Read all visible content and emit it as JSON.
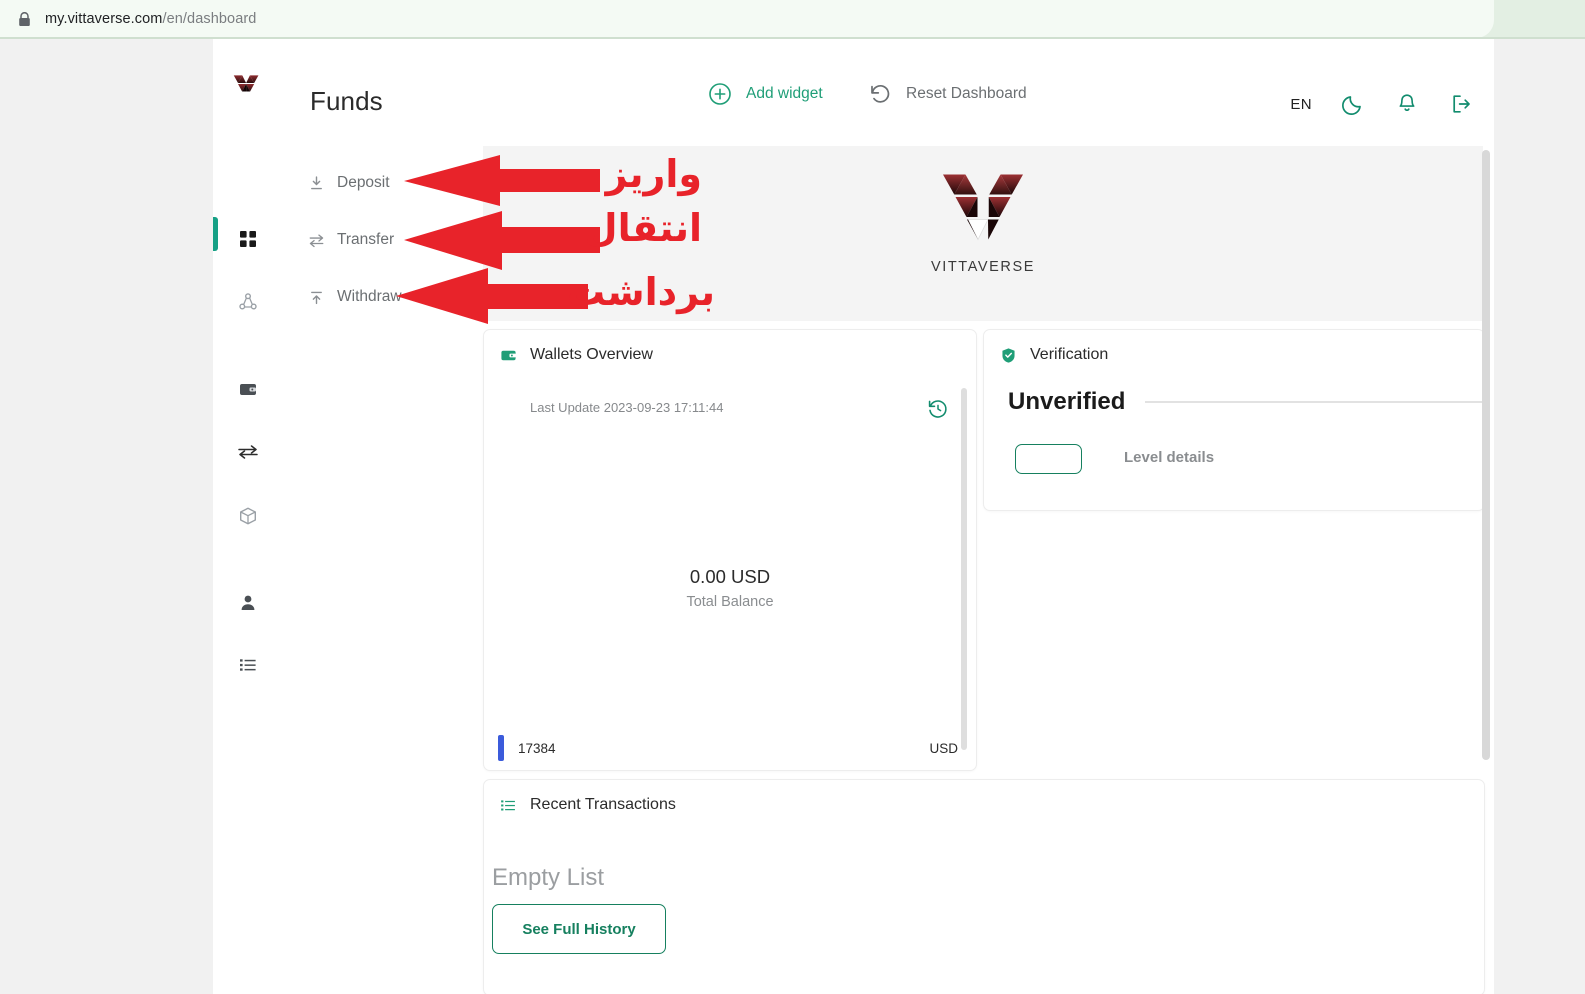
{
  "browser": {
    "lock_icon": "lock-icon",
    "url_host": "my.vittaverse.com",
    "url_path": "/en/dashboard"
  },
  "rail": {
    "logo_alt": "vittaverse-logo",
    "items": [
      {
        "name": "dashboard",
        "icon": "grid-icon",
        "active": true
      },
      {
        "name": "nodes",
        "icon": "network-icon",
        "active": false
      },
      {
        "name": "wallet",
        "icon": "wallet-icon",
        "active": false
      },
      {
        "name": "exchange",
        "icon": "exchange-arrows-icon",
        "active": false
      },
      {
        "name": "packages",
        "icon": "box-icon",
        "active": false
      },
      {
        "name": "profile",
        "icon": "person-icon",
        "active": false
      },
      {
        "name": "reports",
        "icon": "list-icon",
        "active": false
      }
    ]
  },
  "funds": {
    "title": "Funds",
    "items": [
      {
        "label": "Deposit",
        "icon": "arrow-down-to-line-icon"
      },
      {
        "label": "Transfer",
        "icon": "two-way-arrows-icon"
      },
      {
        "label": "Withdraw",
        "icon": "arrow-up-from-line-icon"
      }
    ]
  },
  "toolbar": {
    "add_widget_label": "Add widget",
    "add_widget_icon": "plus-circle-icon",
    "reset_label": "Reset Dashboard",
    "reset_icon": "undo-icon",
    "language": "EN",
    "theme_icon": "moon-icon",
    "notifications_icon": "bell-icon",
    "logout_icon": "logout-icon"
  },
  "banner": {
    "logo_icon": "vittaverse-triangle-v-logo",
    "wordmark": "VITTAVERSE"
  },
  "wallets": {
    "title": "Wallets Overview",
    "icon": "wallet-icon",
    "last_update": "Last Update 2023-09-23 17:11:44",
    "refresh_icon": "history-refresh-icon",
    "total_amount": "0.00 USD",
    "total_label": "Total Balance",
    "legend": {
      "color": "#3b5bdb",
      "id": "17384",
      "currency": "USD"
    }
  },
  "verification": {
    "title": "Verification",
    "icon": "shield-check-icon",
    "status": "Unverified",
    "level_details_label": "Level details"
  },
  "transactions": {
    "title": "Recent Transactions",
    "icon": "list-icon",
    "empty_text": "Empty List",
    "button_label": "See Full History"
  },
  "annotations": {
    "color": "#e8232a",
    "items": [
      {
        "text": "واریز",
        "target": "Deposit"
      },
      {
        "text": "انتقال",
        "target": "Transfer"
      },
      {
        "text": "برداشت",
        "target": "Withdraw"
      }
    ]
  },
  "theme": {
    "accent_green": "#16805f",
    "active_teal": "#16a085",
    "logo_maroon": "#7e1f22",
    "legend_blue": "#3b5bdb"
  }
}
